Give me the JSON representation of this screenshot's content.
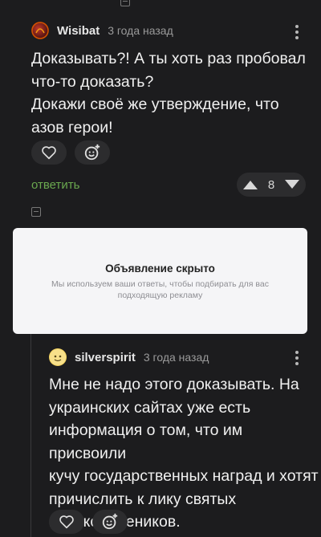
{
  "comment1": {
    "author": "Wisibat",
    "time": "3 года назад",
    "lines": [
      "Доказывать?! А ты хоть раз пробовал",
      "что-то доказать?",
      "Докажи своё же утверждение, что",
      "азов герои!"
    ],
    "reply_label": "ответить",
    "votes": "8",
    "icons": [
      "like-heart-icon",
      "add-reaction-icon",
      "upvote-icon",
      "downvote-icon",
      "more-vertical-icon"
    ]
  },
  "ad": {
    "title": "Объявление скрыто",
    "subtitle": "Мы используем ваши ответы, чтобы подбирать для вас подходящую рекламу"
  },
  "comment2": {
    "author": "silverspirit",
    "time": "3 года назад",
    "lines": [
      "Мне не надо этого доказывать. На",
      "украинских сайтах уже есть",
      "информация о том, что им присвоили",
      "кучу государственных наград и хотят",
      "причислить к лику святых",
      "великомучеников."
    ],
    "icons": [
      "like-heart-icon",
      "add-reaction-icon",
      "more-vertical-icon"
    ]
  },
  "colors": {
    "background": "#1c1c1e",
    "reply": "#6aa84f",
    "button": "#2c2c2e",
    "ad_bg": "#f5f5f7"
  }
}
